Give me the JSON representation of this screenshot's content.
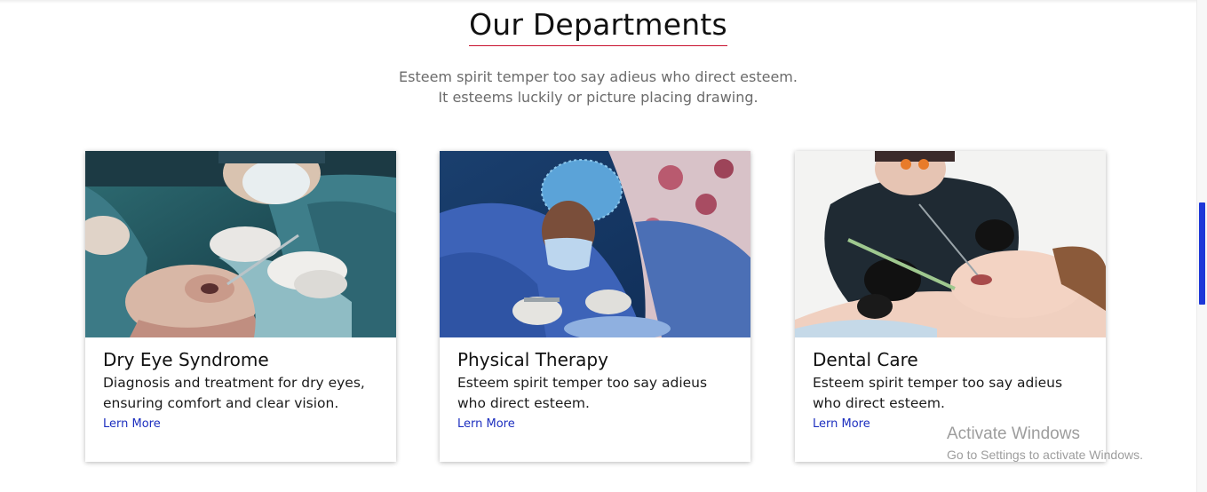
{
  "section": {
    "title": "Our Departments",
    "intro_line1": "Esteem spirit temper too say adieus who direct esteem.",
    "intro_line2": "It esteems luckily or picture placing drawing."
  },
  "departments": [
    {
      "title": "Dry Eye Syndrome",
      "description": "Diagnosis and treatment for dry eyes, ensuring comfort and clear vision.",
      "link": "Lern More",
      "image": "eye-surgery-photo"
    },
    {
      "title": "Physical Therapy",
      "description": "Esteem spirit temper too say adieus who direct esteem.",
      "link": "Lern More",
      "image": "operating-room-surgeons-photo"
    },
    {
      "title": "Dental Care",
      "description": "Esteem spirit temper too say adieus who direct esteem.",
      "link": "Lern More",
      "image": "dentist-patient-photo"
    }
  ],
  "watermark": {
    "title": "Activate Windows",
    "subtitle": "Go to Settings to activate Windows."
  },
  "colors": {
    "title_underline": "#c8102e",
    "link": "#1d2fbf",
    "scrollbar_thumb": "#1d37d8"
  }
}
